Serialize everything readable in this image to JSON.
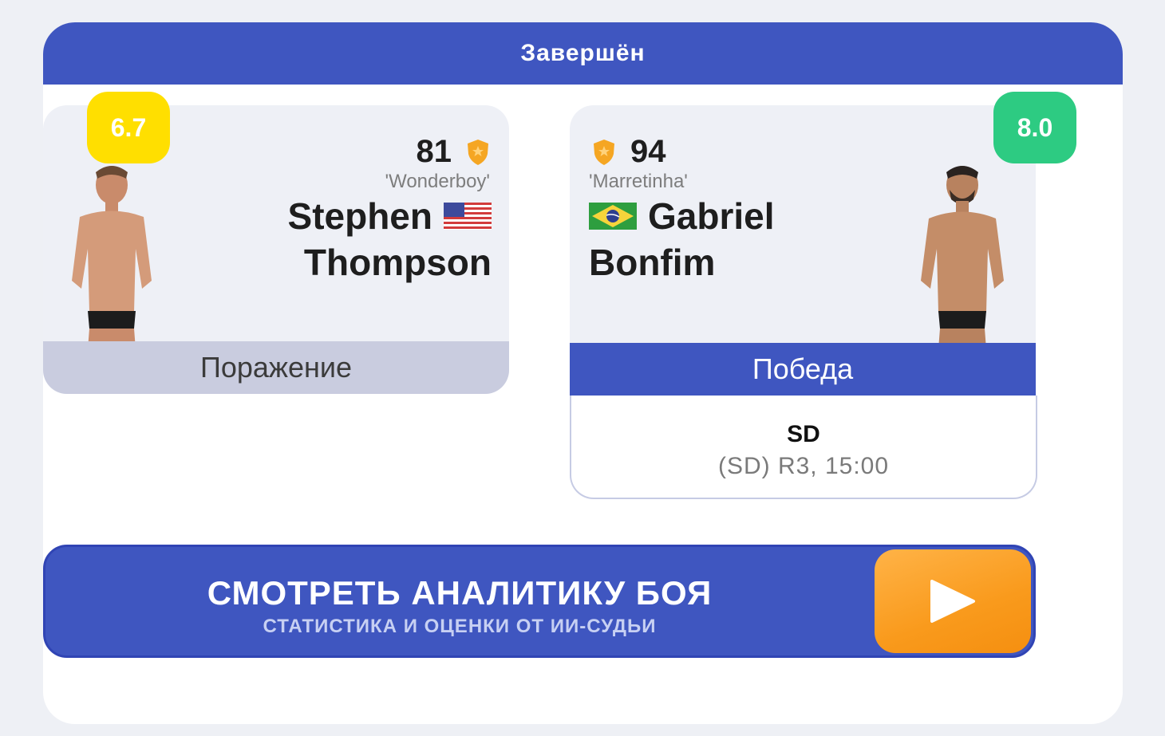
{
  "status": "Завершён",
  "fighter_left": {
    "rating": "6.7",
    "rating_color": "#ffdf00",
    "rank": "81",
    "nickname": "'Wonderboy'",
    "first_name": "Stephen",
    "last_name": "Thompson",
    "flag": "usa-flag",
    "result": "Поражение"
  },
  "fighter_right": {
    "rating": "8.0",
    "rating_color": "#2dcb82",
    "rank": "94",
    "nickname": "'Marretinha'",
    "first_name": "Gabriel",
    "last_name": "Bonfim",
    "flag": "brazil-flag",
    "result": "Победа"
  },
  "method": {
    "code": "SD",
    "detail": "(SD) R3, 15:00"
  },
  "cta": {
    "title": "СМОТРЕТЬ АНАЛИТИКУ БОЯ",
    "subtitle": "СТАТИСТИКА И ОЦЕНКИ ОТ ИИ-СУДЬИ",
    "icon": "play-icon"
  },
  "colors": {
    "primary": "#3f56c0",
    "loss_bar": "#c9ccdf",
    "shield": "#f5a623",
    "cta_button": "#f99a1c"
  }
}
